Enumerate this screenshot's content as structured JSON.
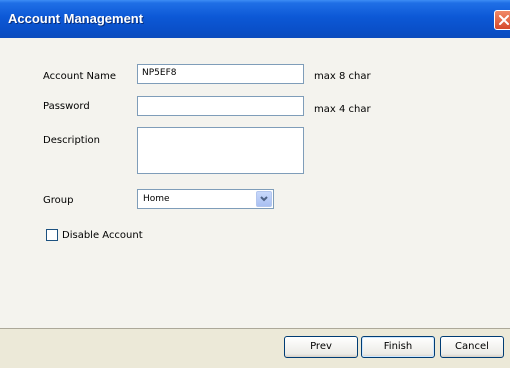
{
  "window": {
    "title": "Account Management"
  },
  "form": {
    "account_name_label": "Account Name",
    "account_name_value": "NP5EF8",
    "account_name_hint": "max 8 char",
    "password_label": "Password",
    "password_value": "",
    "password_hint": "max 4 char",
    "description_label": "Description",
    "description_value": "",
    "group_label": "Group",
    "group_value": "Home",
    "disable_account_label": "Disable Account",
    "disable_account_checked": false
  },
  "buttons": {
    "prev": "Prev",
    "finish": "Finish",
    "cancel": "Cancel"
  },
  "icons": {
    "close": "close-icon",
    "dropdown": "chevron-down-icon"
  },
  "colors": {
    "titlebar": "#0a4fc8",
    "close": "#d6492a",
    "panel": "#f4f3ee",
    "footer": "#ece9d8",
    "field_border": "#7f9db9"
  }
}
